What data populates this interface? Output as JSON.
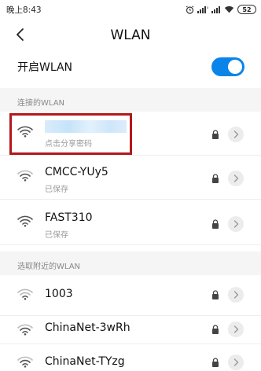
{
  "status_bar": {
    "time": "晚上8:43",
    "battery": "52"
  },
  "header": {
    "title": "WLAN"
  },
  "wlan_toggle": {
    "label": "开启WLAN",
    "enabled": true,
    "accent": "#0a84e8"
  },
  "connected_section": {
    "title": "连接的WLAN",
    "network": {
      "name_hidden": true,
      "subtitle": "点击分享密码",
      "locked": true
    }
  },
  "saved_networks": [
    {
      "name": "CMCC-YUy5",
      "subtitle": "已保存",
      "locked": true
    },
    {
      "name": "FAST310",
      "subtitle": "已保存",
      "locked": true
    }
  ],
  "nearby_section": {
    "title": "选取附近的WLAN",
    "networks": [
      {
        "name": "1003",
        "locked": true
      },
      {
        "name": "ChinaNet-3wRh",
        "locked": true
      },
      {
        "name": "ChinaNet-TYzg",
        "locked": true
      }
    ]
  },
  "icons": {
    "back": "chevron-left-icon",
    "wifi": "wifi-icon",
    "lock": "lock-icon",
    "arrow": "chevron-right-icon"
  }
}
